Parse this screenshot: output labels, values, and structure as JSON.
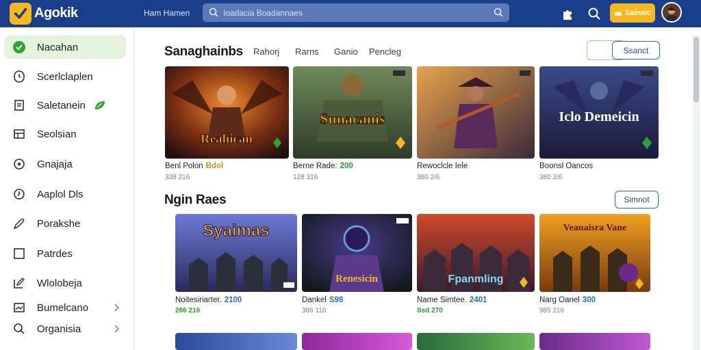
{
  "app": {
    "brand": "Agokik",
    "top_link": "Ham Hamen"
  },
  "search": {
    "placeholder": "Ioadacia Boadannaes"
  },
  "coins": {
    "label": "Sainaic"
  },
  "sidebar": {
    "items": [
      {
        "label": "Nacahan",
        "icon": "check-circle-icon",
        "active": true
      },
      {
        "label": "Scerlclaplen",
        "icon": "clock-icon"
      },
      {
        "label": "Saletanein",
        "icon": "document-icon",
        "badge": "leaf-badge-icon"
      },
      {
        "label": "Seolsian",
        "icon": "grid-icon"
      },
      {
        "label": "Gnajaja",
        "icon": "circle-icon"
      },
      {
        "label": "Aaplol Dls",
        "icon": "alarm-icon"
      },
      {
        "label": "Porakshe",
        "icon": "pen-icon"
      },
      {
        "label": "Patrdes",
        "icon": "square-icon"
      },
      {
        "label": "Wlolobeja",
        "icon": "edit-icon"
      },
      {
        "label": "Bumelcano",
        "icon": "image-icon",
        "chevron": true
      },
      {
        "label": "Organisia",
        "icon": "search-icon",
        "chevron": true
      }
    ]
  },
  "section1": {
    "title": "Sanaghainbs",
    "tabs": [
      "Rahorj",
      "Rarns",
      "Ganio",
      "Pencleg"
    ],
    "button": "Ssanct",
    "cards": [
      {
        "art": "Reahican",
        "title": "Benl Polon",
        "num": "Bdol",
        "num_color": "#b8931b",
        "sub": "338 216",
        "sub_green": false
      },
      {
        "art": "Sunacanis",
        "title": "Berne Rade:",
        "num": "200",
        "num_color": "#2e9b2a",
        "sub": "128 316",
        "sub_green": false
      },
      {
        "art": "",
        "title": "Rewoclcle Iele",
        "num": "",
        "num_color": "#1d1f24",
        "sub": "380 2/6",
        "sub_green": false
      },
      {
        "art": "Iclo Demeicin",
        "title": "Boonsl Oancos",
        "num": "",
        "num_color": "#1d1f24",
        "sub": "380 2/6",
        "sub_green": false
      }
    ]
  },
  "section2": {
    "title": "Ngin Raes",
    "button": "Simnot",
    "cards": [
      {
        "art": "Syaimas",
        "title": "Noitesiriarter.",
        "num": "2100",
        "num_color": "#2a6fb5",
        "sub": "286 216",
        "sub_green": true
      },
      {
        "art": "Renesicin",
        "title": "Dankel",
        "num": "S98",
        "num_color": "#2a6fb5",
        "sub": "386 116",
        "sub_green": false
      },
      {
        "art": "Fpanmling",
        "title": "Name Simtee.",
        "num": "2401",
        "num_color": "#2a6fb5",
        "sub": "Ssd 270",
        "sub_green": true
      },
      {
        "art": "Veauaisra Vane",
        "title": "Narg Oanel",
        "num": "300",
        "num_color": "#2a6fb5",
        "sub": "985 216",
        "sub_green": false
      }
    ]
  },
  "colors": {
    "topbar": "#1a3f8a",
    "accent": "#f5b91d",
    "active_bg": "#e3f3de",
    "green": "#2e9b2a"
  }
}
